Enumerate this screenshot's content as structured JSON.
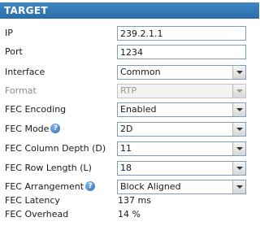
{
  "section": {
    "title": "TARGET"
  },
  "fields": {
    "ip": {
      "label": "IP",
      "value": "239.2.1.1"
    },
    "port": {
      "label": "Port",
      "value": "1234"
    },
    "interface": {
      "label": "Interface",
      "value": "Common"
    },
    "format": {
      "label": "Format",
      "value": "RTP",
      "disabled": true
    },
    "fec_encoding": {
      "label": "FEC Encoding",
      "value": "Enabled"
    },
    "fec_mode": {
      "label": "FEC Mode",
      "value": "2D",
      "help_icon": "question-mark"
    },
    "fec_column_depth": {
      "label": "FEC Column Depth (D)",
      "value": "11"
    },
    "fec_row_length": {
      "label": "FEC Row Length (L)",
      "value": "18"
    },
    "fec_arrangement": {
      "label": "FEC Arrangement",
      "value": "Block Aligned",
      "help_icon": "question-mark"
    }
  },
  "readouts": {
    "fec_latency": {
      "label": "FEC Latency",
      "value": "137 ms"
    },
    "fec_overhead": {
      "label": "FEC Overhead",
      "value": "14 %"
    }
  },
  "colors": {
    "header_bg": "#2a6ea8",
    "header_text": "#ffffff",
    "field_border": "#7f9db9",
    "help_icon": "#2f6fb3"
  }
}
